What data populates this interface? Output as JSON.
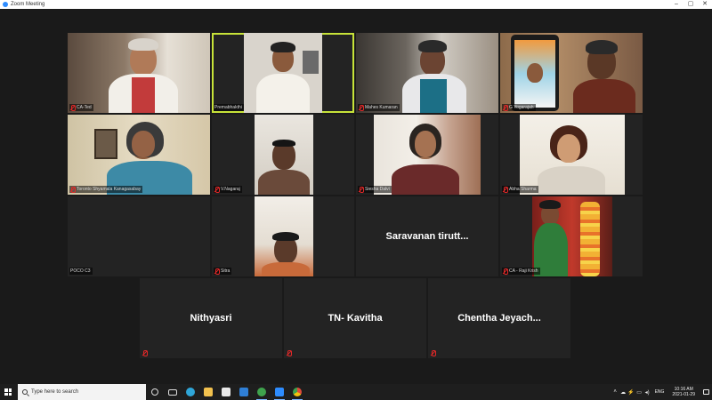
{
  "window": {
    "title": "Zoom Meeting",
    "controls": [
      "–",
      "▢",
      "✕"
    ]
  },
  "participants": [
    {
      "name": "CA-Ted",
      "video": true,
      "muted": true
    },
    {
      "name": "Premabhakthi",
      "video": true,
      "muted": false,
      "active_speaker": true
    },
    {
      "name": "Mahes Kumaran",
      "video": true,
      "muted": true
    },
    {
      "name": "G Yogarajah",
      "video": true,
      "muted": true
    },
    {
      "name": "Toronto Shyamala Kanagasabay",
      "video": true,
      "muted": true
    },
    {
      "name": "V.Nagaraj",
      "video": true,
      "muted": true
    },
    {
      "name": "Siesha Dalvi",
      "video": true,
      "muted": true
    },
    {
      "name": "Abha Sharma",
      "video": true,
      "muted": true
    },
    {
      "name": "POCO C3",
      "video": false,
      "muted": false
    },
    {
      "name": "Sitra",
      "video": true,
      "muted": true
    },
    {
      "name": "Saravanan tirutt...",
      "video": false,
      "muted": false
    },
    {
      "name": "CA - Raji Krish",
      "video": true,
      "muted": true
    },
    {
      "name": "Nithyasri",
      "video": false,
      "muted": true
    },
    {
      "name": "TN- Kavitha",
      "video": false,
      "muted": true
    },
    {
      "name": "Chentha Jeyach...",
      "video": false,
      "muted": true
    }
  ],
  "taskbar": {
    "search_placeholder": "Type here to search",
    "pinned": [
      {
        "name": "task-view",
        "color": "#dddddd"
      },
      {
        "name": "cortana",
        "color": "#dddddd"
      },
      {
        "name": "edge",
        "color": "#2fa6d8"
      },
      {
        "name": "file-explorer",
        "color": "#f2c14e"
      },
      {
        "name": "store",
        "color": "#e9e9e9"
      },
      {
        "name": "mail",
        "color": "#2f7fd6"
      },
      {
        "name": "chrome-green",
        "color": "#3fa34d"
      },
      {
        "name": "zoom",
        "color": "#2d8cff"
      },
      {
        "name": "chrome",
        "color": "#e04b3a"
      }
    ],
    "tray": {
      "icons": [
        "˄",
        "☁",
        "⚡",
        "▭",
        "◂)"
      ],
      "language": "ENG",
      "time": "10:16 AM",
      "date": "2021-01-29"
    }
  }
}
